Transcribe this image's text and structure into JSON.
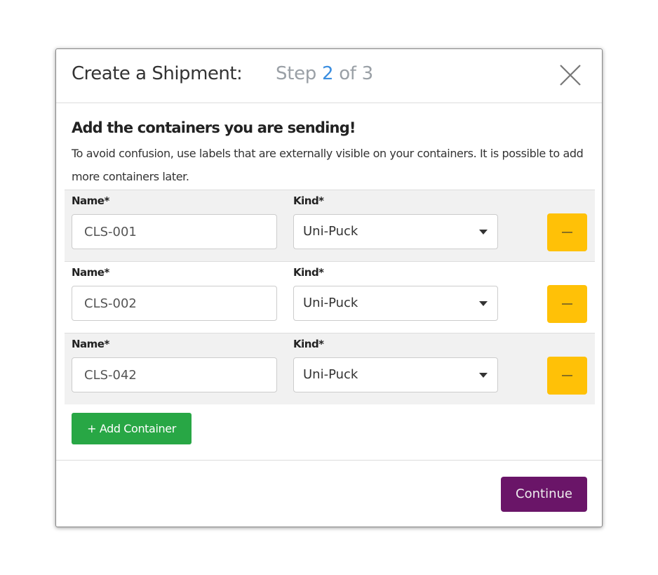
{
  "header": {
    "title": "Create a Shipment:",
    "step_prefix": "Step",
    "step_current": "2",
    "step_suffix": "of 3"
  },
  "heading": "Add the containers you are sending!",
  "description": "To avoid confusion, use labels that are externally visible on your containers. It is possible to add more containers later.",
  "labels": {
    "name": "Name*",
    "kind": "Kind*"
  },
  "containers": [
    {
      "name": "CLS-001",
      "kind": "Uni-Puck"
    },
    {
      "name": "CLS-002",
      "kind": "Uni-Puck"
    },
    {
      "name": "CLS-042",
      "kind": "Uni-Puck"
    }
  ],
  "add_button": "+ Add Container",
  "continue_button": "Continue",
  "colors": {
    "step_accent": "#3b8ee0",
    "remove": "#ffc107",
    "add": "#28a745",
    "continue": "#6a1568"
  }
}
